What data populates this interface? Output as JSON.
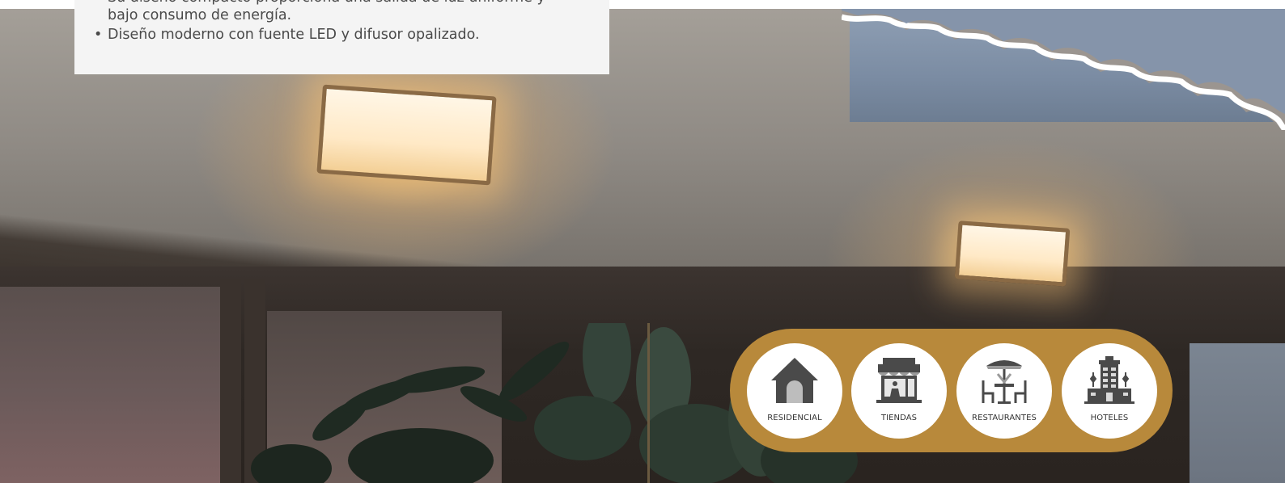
{
  "info_card": {
    "bullets": [
      "Su diseño compacto proporciona una salida de luz uniforme y bajo consumo de energía.",
      "Diseño moderno con fuente LED y difusor opalizado."
    ]
  },
  "categories": [
    {
      "label": "RESIDENCIAL",
      "icon": "house-icon"
    },
    {
      "label": "TIENDAS",
      "icon": "store-icon"
    },
    {
      "label": "RESTAURANTES",
      "icon": "restaurant-table-icon"
    },
    {
      "label": "HOTELES",
      "icon": "hotel-building-icon"
    }
  ],
  "colors": {
    "pill_background": "#b8893b",
    "card_background": "#f4f4f4",
    "icon_color": "#4a4a4a",
    "text_color": "#4a4a4a"
  }
}
